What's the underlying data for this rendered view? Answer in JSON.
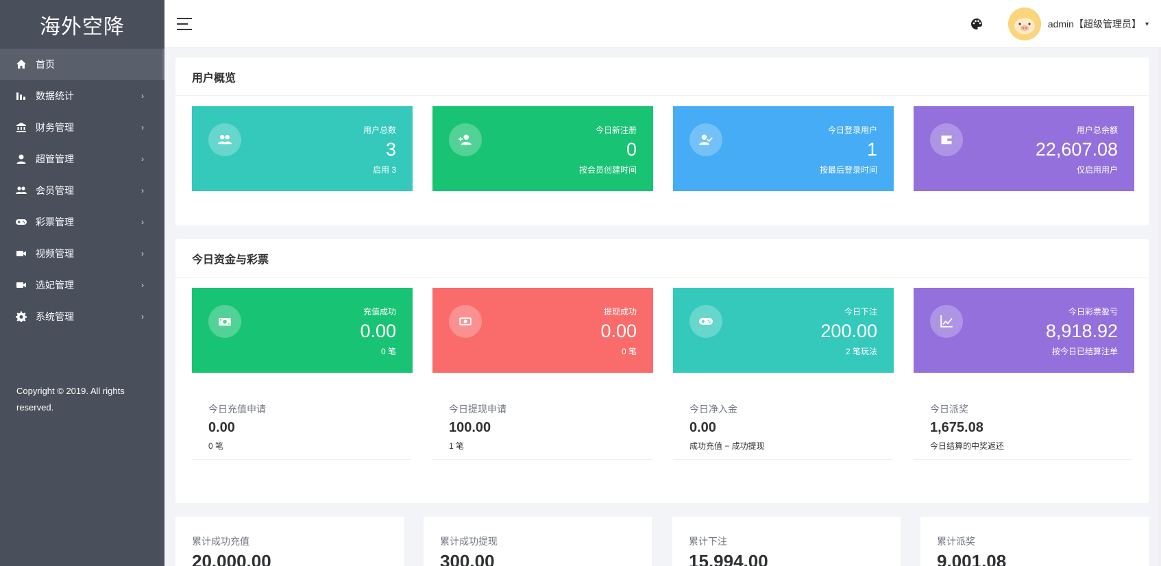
{
  "brand": "海外空降",
  "sidebar": {
    "items": [
      {
        "label": "首页",
        "icon": "home-icon",
        "has_arrow": false,
        "active": true
      },
      {
        "label": "数据统计",
        "icon": "bar-chart-icon",
        "has_arrow": true
      },
      {
        "label": "财务管理",
        "icon": "bank-icon",
        "has_arrow": true
      },
      {
        "label": "超管管理",
        "icon": "user-icon",
        "has_arrow": true
      },
      {
        "label": "会员管理",
        "icon": "users-icon",
        "has_arrow": true
      },
      {
        "label": "彩票管理",
        "icon": "gamepad-icon",
        "has_arrow": true
      },
      {
        "label": "视频管理",
        "icon": "video-icon",
        "has_arrow": true
      },
      {
        "label": "选妃管理",
        "icon": "video-icon",
        "has_arrow": true
      },
      {
        "label": "系统管理",
        "icon": "gear-icon",
        "has_arrow": true
      }
    ],
    "arrow": "›",
    "copyright": "Copyright © 2019. All rights reserved."
  },
  "header": {
    "user": "admin【超级管理员】",
    "caret": "▾"
  },
  "overview": {
    "title": "用户概览",
    "cards": [
      {
        "label": "用户总数",
        "value": "3",
        "sub": "启用 3",
        "color": "#34c9bb",
        "icon": "users-icon"
      },
      {
        "label": "今日新注册",
        "value": "0",
        "sub": "按会员创建时间",
        "color": "#19c374",
        "icon": "user-plus-icon"
      },
      {
        "label": "今日登录用户",
        "value": "1",
        "sub": "按最后登录时间",
        "color": "#45acf5",
        "icon": "user-check-icon"
      },
      {
        "label": "用户总余额",
        "value": "22,607.08",
        "sub": "仅启用用户",
        "color": "#9370db",
        "icon": "wallet-icon"
      }
    ]
  },
  "today": {
    "title": "今日资金与彩票",
    "cards": [
      {
        "label": "充值成功",
        "value": "0.00",
        "sub": "0 笔",
        "color": "#19c374",
        "icon": "money-icon"
      },
      {
        "label": "提现成功",
        "value": "0.00",
        "sub": "0 笔",
        "color": "#fa6b6b",
        "icon": "cash-icon"
      },
      {
        "label": "今日下注",
        "value": "200.00",
        "sub": "2 笔玩法",
        "color": "#34c9bb",
        "icon": "gamepad-icon"
      },
      {
        "label": "今日彩票盈亏",
        "value": "8,918.92",
        "sub": "按今日已结算注单",
        "color": "#9370db",
        "icon": "trend-icon"
      }
    ],
    "minis": [
      {
        "label": "今日充值申请",
        "value": "0.00",
        "sub": "0 笔"
      },
      {
        "label": "今日提现申请",
        "value": "100.00",
        "sub": "1 笔"
      },
      {
        "label": "今日净入金",
        "value": "0.00",
        "sub": "成功充值 − 成功提现"
      },
      {
        "label": "今日派奖",
        "value": "1,675.08",
        "sub": "今日结算的中奖返还"
      }
    ]
  },
  "totals": [
    {
      "label": "累计成功充值",
      "value": "20,000.00"
    },
    {
      "label": "累计成功提现",
      "value": "300.00"
    },
    {
      "label": "累计下注",
      "value": "15,994.00"
    },
    {
      "label": "累计派奖",
      "value": "9,001.08"
    }
  ]
}
